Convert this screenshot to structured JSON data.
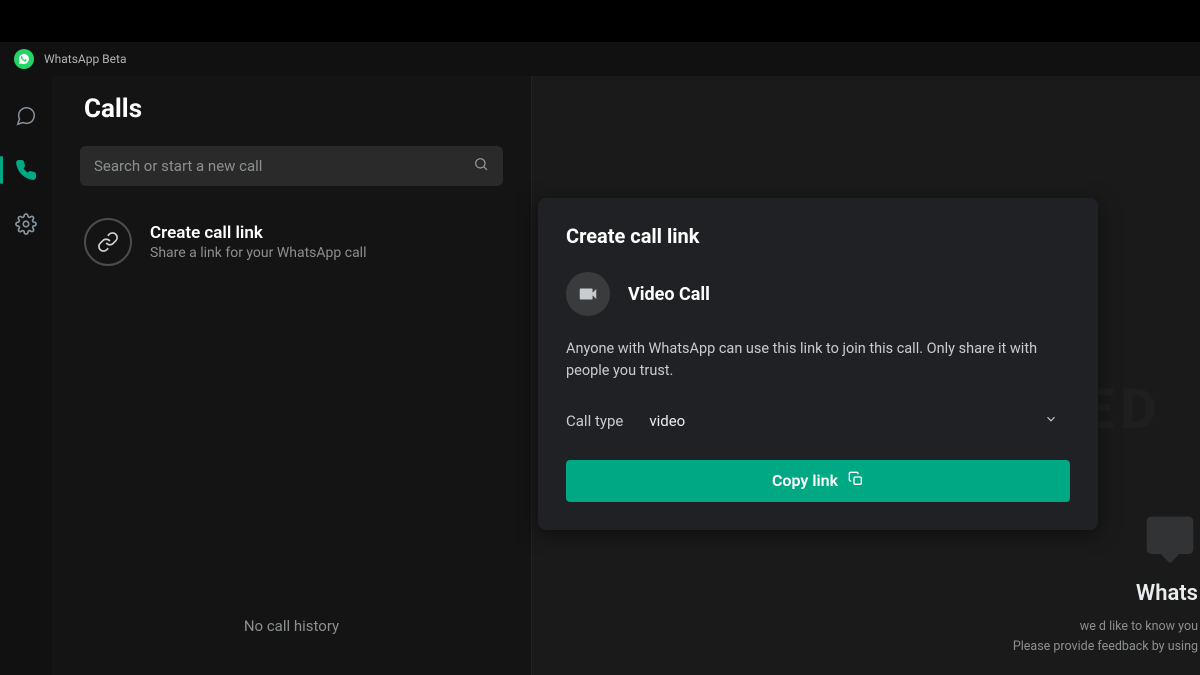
{
  "app": {
    "title": "WhatsApp Beta"
  },
  "nav": {
    "items": [
      {
        "name": "chats"
      },
      {
        "name": "calls"
      },
      {
        "name": "settings"
      }
    ]
  },
  "calls_pane": {
    "title": "Calls",
    "search_placeholder": "Search or start a new call",
    "create_link": {
      "title": "Create call link",
      "subtitle": "Share a link for your WhatsApp call"
    },
    "empty_state": "No call history"
  },
  "modal": {
    "title": "Create call link",
    "call_kind_label": "Video Call",
    "description": "Anyone with WhatsApp can use this link to join this call. Only share it with people you trust.",
    "type_label": "Call type",
    "type_value": "video",
    "copy_button": "Copy link"
  },
  "feedback": {
    "title": "Whats",
    "line1": "we d like to know you",
    "line2": "Please provide feedback by using"
  }
}
